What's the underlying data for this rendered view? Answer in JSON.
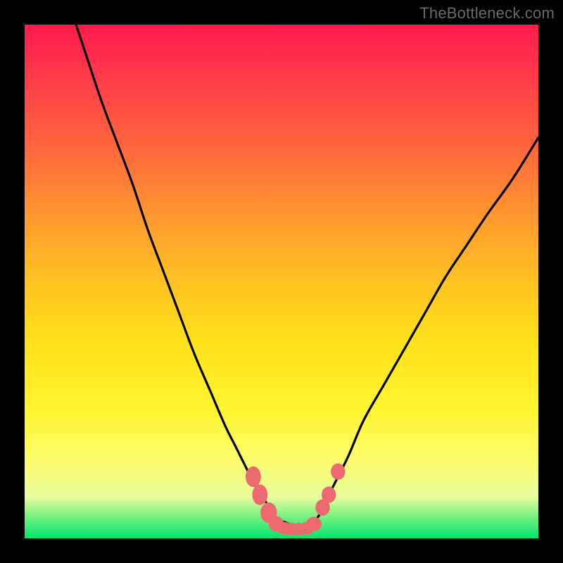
{
  "watermark": "TheBottleneck.com",
  "chart_data": {
    "type": "line",
    "title": "",
    "xlabel": "",
    "ylabel": "",
    "xlim": [
      0,
      100
    ],
    "ylim": [
      0,
      100
    ],
    "grid": false,
    "series": [
      {
        "name": "curve",
        "x": [
          10,
          12,
          15,
          18,
          21,
          24,
          27,
          30,
          33,
          36,
          39,
          41,
          43,
          45,
          47,
          49,
          51,
          53,
          55,
          57,
          58,
          60,
          63,
          66,
          70,
          74,
          78,
          82,
          86,
          90,
          95,
          100
        ],
        "values": [
          100,
          94,
          85,
          77,
          69,
          60,
          52,
          44,
          36,
          29,
          22,
          18,
          14,
          10,
          7,
          4,
          3,
          2,
          2,
          4,
          6,
          10,
          16,
          23,
          30,
          37,
          44,
          51,
          57,
          63,
          70,
          78
        ]
      }
    ],
    "markers": [
      {
        "x": 44.5,
        "y": 12.0,
        "rx": 1.5,
        "ry": 2.0
      },
      {
        "x": 45.8,
        "y": 8.5,
        "rx": 1.5,
        "ry": 2.0
      },
      {
        "x": 47.5,
        "y": 5.0,
        "rx": 1.6,
        "ry": 2.0
      },
      {
        "x": 49.0,
        "y": 2.8,
        "rx": 1.5,
        "ry": 1.5
      },
      {
        "x": 50.5,
        "y": 2.0,
        "rx": 1.5,
        "ry": 1.2
      },
      {
        "x": 52.0,
        "y": 1.8,
        "rx": 1.5,
        "ry": 1.2
      },
      {
        "x": 53.5,
        "y": 1.8,
        "rx": 1.5,
        "ry": 1.2
      },
      {
        "x": 55.0,
        "y": 2.0,
        "rx": 1.5,
        "ry": 1.2
      },
      {
        "x": 56.3,
        "y": 2.8,
        "rx": 1.5,
        "ry": 1.4
      },
      {
        "x": 58.0,
        "y": 6.0,
        "rx": 1.4,
        "ry": 1.6
      },
      {
        "x": 59.2,
        "y": 8.5,
        "rx": 1.4,
        "ry": 1.6
      },
      {
        "x": 61.0,
        "y": 13.0,
        "rx": 1.4,
        "ry": 1.6
      }
    ],
    "marker_color": "#ec6a6f",
    "curve_color": "#000000",
    "gradient_stops": [
      {
        "pos": 0,
        "color": "#ff1a4d"
      },
      {
        "pos": 10,
        "color": "#ff3b4a"
      },
      {
        "pos": 25,
        "color": "#ff6a3d"
      },
      {
        "pos": 38,
        "color": "#ff9b2e"
      },
      {
        "pos": 50,
        "color": "#ffc222"
      },
      {
        "pos": 62,
        "color": "#ffe21a"
      },
      {
        "pos": 75,
        "color": "#fff531"
      },
      {
        "pos": 85,
        "color": "#fdfd6e"
      },
      {
        "pos": 92,
        "color": "#e7fd9e"
      },
      {
        "pos": 96,
        "color": "#6ff07e"
      },
      {
        "pos": 100,
        "color": "#00e56b"
      }
    ]
  }
}
